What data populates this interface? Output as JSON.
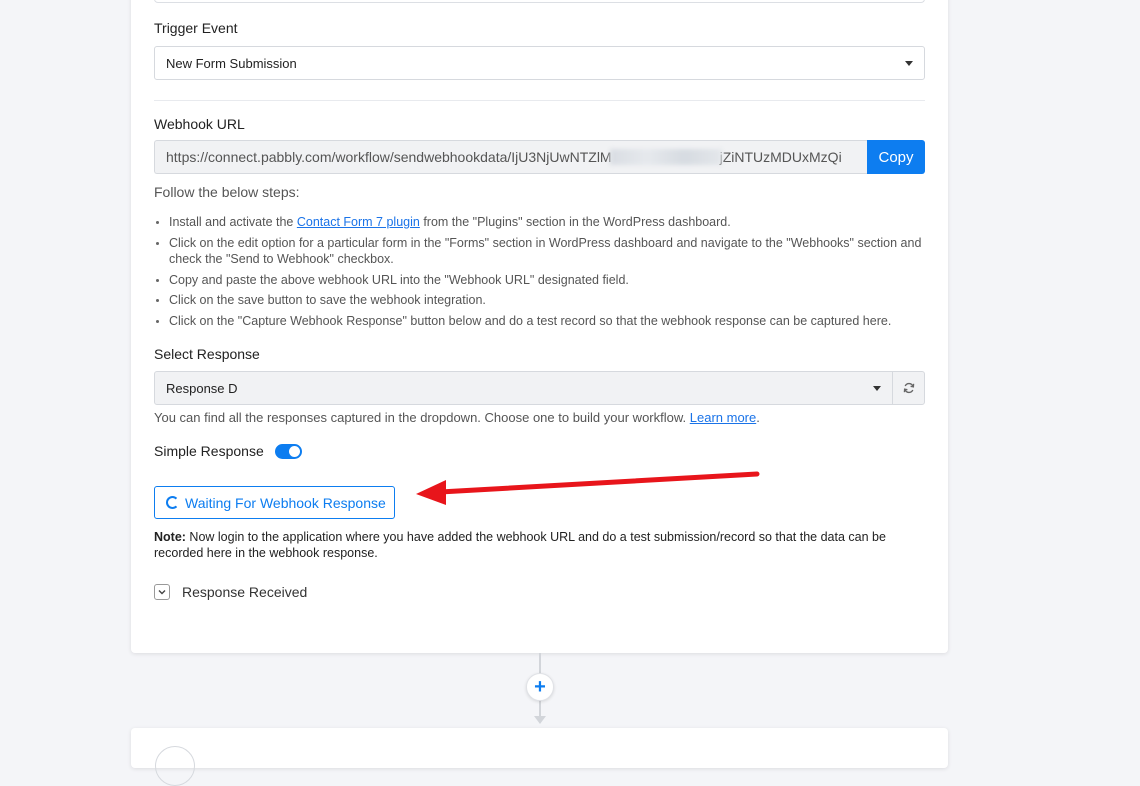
{
  "trigger": {
    "label": "Trigger Event",
    "selected": "New Form Submission"
  },
  "webhook": {
    "label": "Webhook URL",
    "url_start": "https://connect.pabbly.com/workflow/sendwebhookdata/IjU3NjUwNTZlM",
    "url_end": "jZiNTUzMDUxMzQi",
    "copy_label": "Copy"
  },
  "steps": {
    "intro": "Follow the below steps:",
    "items": [
      {
        "before": "Install and activate the ",
        "link": "Contact Form 7 plugin",
        "after": " from the \"Plugins\" section in the WordPress dashboard."
      },
      {
        "text": "Click on the edit option for a particular form in the \"Forms\" section in WordPress dashboard and navigate to the \"Webhooks\" section and check the \"Send to Webhook\" checkbox."
      },
      {
        "text": "Copy and paste the above webhook URL into the \"Webhook URL\" designated field."
      },
      {
        "text": "Click on the save button to save the webhook integration."
      },
      {
        "text": "Click on the \"Capture Webhook Response\" button below and do a test record so that the webhook response can be captured here."
      }
    ]
  },
  "response": {
    "label": "Select Response",
    "selected": "Response D",
    "help_text": "You can find all the responses captured in the dropdown. Choose one to build your workflow. ",
    "help_link": "Learn more",
    "help_end": "."
  },
  "simple_response": {
    "label": "Simple Response",
    "enabled": true
  },
  "waiting_button": "Waiting For Webhook Response",
  "note": {
    "prefix": "Note:",
    "text": " Now login to the application where you have added the webhook URL and do a test submission/record so that the data can be recorded here in the webhook response."
  },
  "response_received": "Response Received",
  "colors": {
    "accent": "#0d7df0",
    "annotation_arrow": "#e8151b"
  },
  "icons": {
    "refresh": "refresh-icon",
    "chevron": "chevron-down-icon",
    "add": "plus-icon"
  }
}
